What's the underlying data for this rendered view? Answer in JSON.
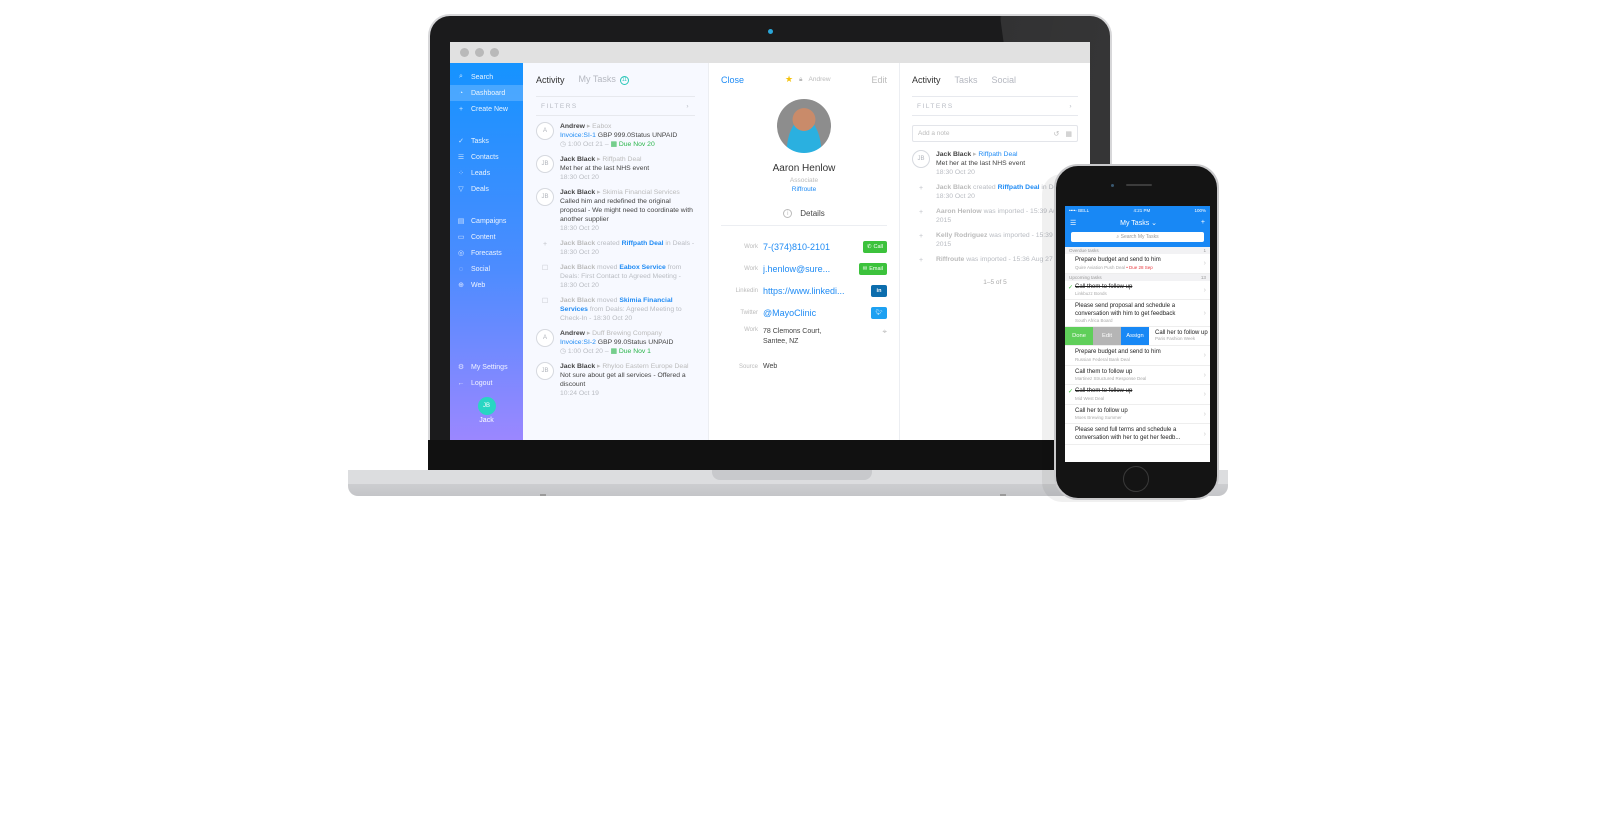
{
  "window": {
    "title_dots": 3
  },
  "sidebar": {
    "items": [
      {
        "label": "Search",
        "icon": "search-icon",
        "glyph": "⌕"
      },
      {
        "label": "Dashboard",
        "icon": "dashboard-icon",
        "glyph": "◔",
        "active": true
      },
      {
        "label": "Create New",
        "icon": "plus-icon",
        "glyph": "+"
      },
      {
        "label": "Tasks",
        "icon": "check-icon",
        "glyph": "✓"
      },
      {
        "label": "Contacts",
        "icon": "list-icon",
        "glyph": "☰"
      },
      {
        "label": "Leads",
        "icon": "leads-icon",
        "glyph": "⁘"
      },
      {
        "label": "Deals",
        "icon": "funnel-icon",
        "glyph": "▽"
      },
      {
        "label": "Campaigns",
        "icon": "campaigns-icon",
        "glyph": "▤"
      },
      {
        "label": "Content",
        "icon": "folder-icon",
        "glyph": "▭"
      },
      {
        "label": "Forecasts",
        "icon": "target-icon",
        "glyph": "◎"
      },
      {
        "label": "Social",
        "icon": "chat-icon",
        "glyph": "◌"
      },
      {
        "label": "Web",
        "icon": "globe-icon",
        "glyph": "⊕"
      }
    ],
    "settings_label": "My Settings",
    "logout_label": "Logout",
    "user_initials": "JB",
    "user_name": "Jack"
  },
  "activity": {
    "tabs": [
      "Activity",
      "My Tasks"
    ],
    "tasks_badge": "11",
    "filters_label": "FILTERS",
    "feed": [
      {
        "avatar": "A",
        "who": "Andrew",
        "context": "Eabox",
        "link": "Invoice:SI-1",
        "text": " GBP 999.0Status UNPAID",
        "time": "1:00 Oct 21",
        "due": "Due Nov 20"
      },
      {
        "avatar": "JB",
        "who": "Jack Black",
        "context": "Riffpath Deal",
        "text": "Met her at the last NHS event",
        "time": "18:30 Oct 20"
      },
      {
        "avatar": "JB",
        "who": "Jack Black",
        "context": "Skimia Financial Services",
        "text": "Called him and redefined the original proposal - We might need to coordinate with another supplier",
        "time": "18:30 Oct 20"
      },
      {
        "who": "Jack Black",
        "pre": " created ",
        "link": "Riffpath Deal",
        "post": " in Deals - 18:30 Oct 20"
      },
      {
        "who": "Jack Black",
        "pre": " moved ",
        "link": "Eabox Service",
        "post": " from Deals: First Contact to Agreed Meeting - 18:30 Oct 20"
      },
      {
        "who": "Jack Black",
        "pre": " moved ",
        "link": "Skimia Financial Services",
        "post": " from Deals: Agreed Meeting to Check-In - 18:30 Oct 20"
      },
      {
        "avatar": "A",
        "who": "Andrew",
        "context": "Duff Brewing Company",
        "link": "Invoice:SI-2",
        "text": " GBP 99.0Status UNPAID",
        "time": "1:00 Oct 20",
        "due": "Due Nov 1"
      },
      {
        "avatar": "JB",
        "who": "Jack Black",
        "context": "Rhyloo Eastern Europe Deal",
        "text": "Not sure about get all services - Offered a discount",
        "time": "10:24 Oct 19"
      }
    ]
  },
  "contact": {
    "close_label": "Close",
    "owner": "Andrew",
    "edit_label": "Edit",
    "name": "Aaron Henlow",
    "role": "Associate",
    "company": "Riffroute",
    "details_label": "Details",
    "rows": [
      {
        "label": "Work",
        "value": "7-(374)810-2101",
        "action": "Call"
      },
      {
        "label": "Work",
        "value": "j.henlow@sure...",
        "action": "Email"
      },
      {
        "label": "Linkedin",
        "value": "https://www.linkedi...",
        "action": "in"
      },
      {
        "label": "Twitter",
        "value": "@MayoClinic",
        "action": "t"
      }
    ],
    "address_label": "Work",
    "address_line1": "78 Clemons Court,",
    "address_line2": "Santee, NZ",
    "source_label": "Source",
    "source_value": "Web"
  },
  "right": {
    "tabs": [
      "Activity",
      "Tasks",
      "Social"
    ],
    "filters_label": "FILTERS",
    "note_placeholder": "Add a note",
    "feed": [
      {
        "avatar": "JB",
        "who": "Jack Black",
        "link": "Riffpath Deal",
        "text": "Met her at the last NHS event",
        "time": "18:30 Oct 20"
      },
      {
        "who": "Jack Black",
        "pre": " created ",
        "link": "Riffpath Deal",
        "post": " in Deals - 18:30 Oct 20"
      },
      {
        "who": "Aaron Henlow",
        "pre": " was imported - 15:39 Aug 27, 2015"
      },
      {
        "who": "Kelly Rodriguez",
        "pre": " was imported - 15:39 Aug 27, 2015"
      },
      {
        "who": "Riffroute",
        "pre": " was imported - 15:36 Aug 27"
      }
    ],
    "pager": "1–5 of 5"
  },
  "phone": {
    "carrier": "••••◦ BELL",
    "time": "4:21 PM",
    "battery": "100%",
    "title": "My Tasks ⌄",
    "search_placeholder": "Search My Tasks",
    "overdue_label": "Overdue tasks",
    "overdue_count": "1",
    "upcoming_label": "Upcoming tasks",
    "upcoming_count": "13",
    "overdue": [
      {
        "title": "Prepare budget and send to him",
        "sub": "Quire Aviation Push Deal",
        "due": "Due 28 Sep"
      }
    ],
    "upcoming_a": [
      {
        "title": "Call them to follow up",
        "sub": "Linkbuzz Bonds",
        "done": true
      },
      {
        "title": "Please send proposal and schedule a conversation with him to get feedback",
        "sub": "South Africa Board"
      }
    ],
    "swipe": {
      "done": "Done",
      "edit": "Edit",
      "assign": "Assign",
      "title": "Call her to follow up",
      "sub": "Paris Fashion Week"
    },
    "upcoming_b": [
      {
        "title": "Prepare budget and send to him",
        "sub": "Russian Federal Bank Deal"
      },
      {
        "title": "Call them to follow up",
        "sub": "Martinez Structured Response Deal"
      },
      {
        "title": "Call them to follow up",
        "sub": "Mid West Deal",
        "done": true
      },
      {
        "title": "Call her to follow up",
        "sub": "Moes Brewing Summer"
      },
      {
        "title": "Please send full terms and schedule a conversation with her to get her feedb...",
        "sub": ""
      }
    ]
  },
  "colors": {
    "accent": "#1f8bf4",
    "success": "#3cc23c",
    "sidebar_top": "#1593ff",
    "sidebar_bottom": "#9b87ff",
    "badge": "#28c6b8"
  }
}
